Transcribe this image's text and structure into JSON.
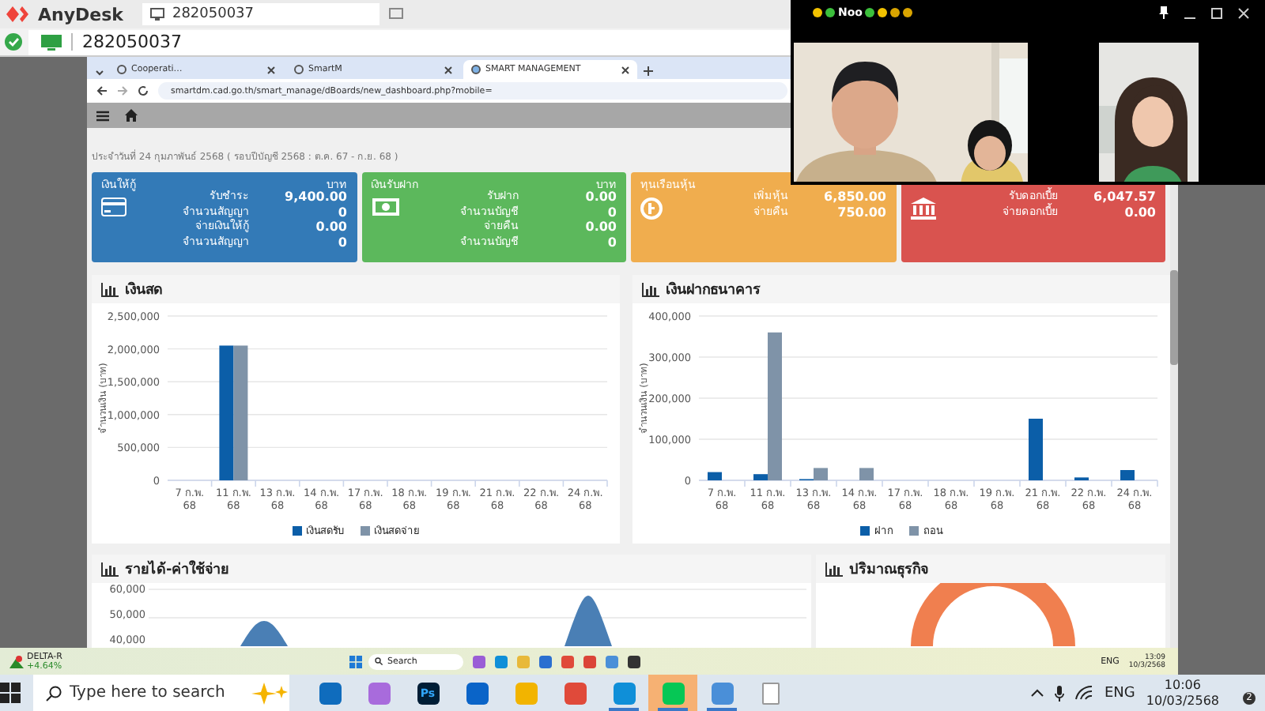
{
  "anydesk": {
    "app_name": "AnyDesk",
    "session_id": "282050037",
    "address": "282050037"
  },
  "browser": {
    "tabs": [
      {
        "title": "Cooperati…",
        "selected": false
      },
      {
        "title": "SmartM",
        "selected": false
      },
      {
        "title": "SMART MANAGEMENT",
        "selected": true
      }
    ],
    "url": "smartdm.cad.go.th/smart_manage/dBoards/new_dashboard.php?mobile="
  },
  "page": {
    "date_line": "ประจำวันที่ 24 กุมภาพันธ์ 2568 ( รอบปีบัญชี 2568 : ต.ค. 67 - ก.ย. 68 )",
    "cards": [
      {
        "title": "เงินให้กู้",
        "unit": "บาท",
        "color": "#337ab7",
        "rows": [
          {
            "label": "รับชำระ",
            "value": "9,400.00"
          },
          {
            "label": "จำนวนสัญญา",
            "value": "0"
          },
          {
            "label": "จ่ายเงินให้กู้",
            "value": "0.00"
          },
          {
            "label": "จำนวนสัญญา",
            "value": "0"
          }
        ]
      },
      {
        "title": "เงินรับฝาก",
        "unit": "บาท",
        "color": "#5cb85c",
        "rows": [
          {
            "label": "รับฝาก",
            "value": "0.00"
          },
          {
            "label": "จำนวนบัญชี",
            "value": "0"
          },
          {
            "label": "จ่ายคืน",
            "value": "0.00"
          },
          {
            "label": "จำนวนบัญชี",
            "value": "0"
          }
        ]
      },
      {
        "title": "ทุนเรือนหุ้น",
        "color": "#f0ad4e",
        "rows": [
          {
            "label": "เพิ่มหุ้น",
            "value": "6,850.00"
          },
          {
            "label": "จ่ายคืน",
            "value": "750.00"
          }
        ]
      },
      {
        "color": "#d9534f",
        "rows": [
          {
            "label": "รับดอกเบี้ย",
            "value": "6,047.57"
          },
          {
            "label": "จ่ายดอกเบี้ย",
            "value": "0.00"
          }
        ]
      }
    ],
    "panels": [
      {
        "kind": "bar",
        "title": "เงินสด",
        "chart_data": {
          "type": "bar",
          "ylabel": "จำนวนเงิน (บาท)",
          "categories": [
            "7 ก.พ. 68",
            "11 ก.พ. 68",
            "13 ก.พ. 68",
            "14 ก.พ. 68",
            "17 ก.พ. 68",
            "18 ก.พ. 68",
            "19 ก.พ. 68",
            "21 ก.พ. 68",
            "22 ก.พ. 68",
            "24 ก.พ. 68"
          ],
          "series": [
            {
              "name": "เงินสดรับ",
              "color": "#0b5ea8",
              "values": [
                0,
                2050000,
                0,
                0,
                0,
                0,
                0,
                0,
                0,
                0
              ]
            },
            {
              "name": "เงินสดจ่าย",
              "color": "#7f93a8",
              "values": [
                0,
                2050000,
                0,
                0,
                0,
                0,
                0,
                0,
                0,
                0
              ]
            }
          ],
          "ylim": [
            0,
            2500000
          ],
          "yticks": [
            {
              "value": 0,
              "label": "0"
            },
            {
              "value": 500000,
              "label": "500,000"
            },
            {
              "value": 1000000,
              "label": "1,000,000"
            },
            {
              "value": 1500000,
              "label": "1,500,000"
            },
            {
              "value": 2000000,
              "label": "2,000,000"
            },
            {
              "value": 2500000,
              "label": "2,500,000"
            }
          ],
          "grid": true,
          "legend": "bottom"
        }
      },
      {
        "kind": "bar",
        "title": "เงินฝากธนาคาร",
        "chart_data": {
          "type": "bar",
          "ylabel": "จำนวนเงิน (บาท)",
          "categories": [
            "7 ก.พ. 68",
            "11 ก.พ. 68",
            "13 ก.พ. 68",
            "14 ก.พ. 68",
            "17 ก.พ. 68",
            "18 ก.พ. 68",
            "19 ก.พ. 68",
            "21 ก.พ. 68",
            "22 ก.พ. 68",
            "24 ก.พ. 68"
          ],
          "series": [
            {
              "name": "ฝาก",
              "color": "#0b5ea8",
              "values": [
                20000,
                15000,
                3000,
                0,
                0,
                0,
                0,
                150000,
                7000,
                25000
              ]
            },
            {
              "name": "ถอน",
              "color": "#7f93a8",
              "values": [
                0,
                360000,
                30000,
                30000,
                0,
                0,
                0,
                0,
                0,
                0
              ]
            }
          ],
          "ylim": [
            0,
            400000
          ],
          "yticks": [
            {
              "value": 0,
              "label": "0"
            },
            {
              "value": 100000,
              "label": "100,000"
            },
            {
              "value": 200000,
              "label": "200,000"
            },
            {
              "value": 300000,
              "label": "300,000"
            },
            {
              "value": 400000,
              "label": "400,000"
            }
          ],
          "grid": true,
          "legend": "bottom"
        }
      },
      {
        "kind": "area",
        "title": "รายได้-ค่าใช้จ่าย",
        "y_tick_labels": [
          "60,000",
          "50,000",
          "40,000"
        ]
      },
      {
        "kind": "donut",
        "title": "ปริมาณธุรกิจ"
      }
    ]
  },
  "remote_taskbar": {
    "ticker": "DELTA-R",
    "change": "+4.64%",
    "search": "Search",
    "language": "ENG",
    "time": "13:09",
    "date": "10/3/2568"
  },
  "local_taskbar": {
    "search_placeholder": "Type here to search",
    "apps": [
      {
        "selected": false,
        "running": false
      },
      {
        "selected": false,
        "running": false
      },
      {
        "selected": false,
        "running": false,
        "label": "Ps"
      },
      {
        "selected": false,
        "running": false
      },
      {
        "selected": false,
        "running": false
      },
      {
        "selected": false,
        "running": false
      },
      {
        "selected": false,
        "running": true
      },
      {
        "selected": true,
        "running": true
      },
      {
        "selected": false,
        "running": true
      },
      {
        "selected": false,
        "running": false
      }
    ],
    "language": "ENG",
    "time": "10:06",
    "date": "10/03/2568",
    "notifications": "2"
  },
  "video_call": {
    "title": "Noo"
  }
}
